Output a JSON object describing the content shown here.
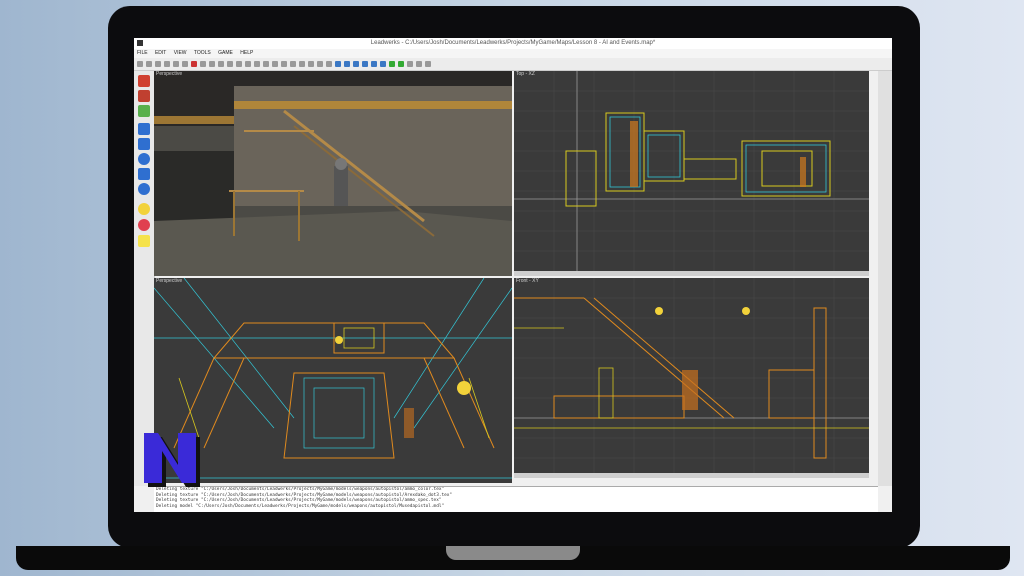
{
  "window": {
    "title": "Leadwerks - C:/Users/Josh/Documents/Leadwerks/Projects/MyGame/Maps/Lesson 8 - AI and Events.map*"
  },
  "menu": [
    "FILE",
    "EDIT",
    "VIEW",
    "TOOLS",
    "GAME",
    "HELP"
  ],
  "viewports": {
    "top_left": {
      "label": "Perspective"
    },
    "top_right": {
      "label": "Top - XZ"
    },
    "bottom_left": {
      "label": "Perspective"
    },
    "bottom_right": {
      "label": "Front - XY"
    }
  },
  "console": {
    "lines": [
      "Deleting texture \"C:/Users/Josh/Documents/Leadwerks/Projects/MyGame/models/weapons/autopistol/ammo_color.tex\"",
      "Deleting texture \"C:/Users/Josh/Documents/Leadwerks/Projects/MyGame/models/weapons/autopistol/Arexdako_dot3.tex\"",
      "Deleting texture \"C:/Users/Josh/Documents/Leadwerks/Projects/MyGame/models/weapons/autopistol/ammo_spec.tex\"",
      "Deleting model \"C:/Users/Josh/Documents/Leadwerks/Projects/MyGame/models/weapons/autopistol/Musedapistol.mdl\""
    ]
  },
  "colors": {
    "accent": "#3b78c4",
    "wire_orange": "#e08a1e",
    "wire_cyan": "#33c6d6",
    "wire_yellow": "#d8c91e",
    "logo_blue": "#3a2ad8"
  },
  "logo": {
    "icon": "n-logo-icon"
  }
}
